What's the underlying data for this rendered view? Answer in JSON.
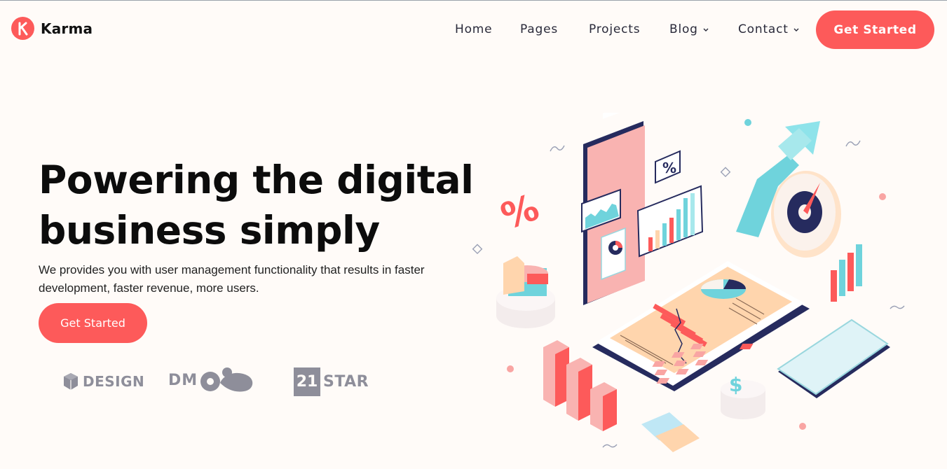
{
  "brand": {
    "name": "Karma",
    "accent": "#fd5a5a"
  },
  "nav": {
    "items": [
      {
        "label": "Home",
        "has_dropdown": false
      },
      {
        "label": "Pages",
        "has_dropdown": false
      },
      {
        "label": "Projects",
        "has_dropdown": false
      },
      {
        "label": "Blog",
        "has_dropdown": true
      },
      {
        "label": "Contact",
        "has_dropdown": true
      }
    ],
    "cta_label": "Get Started"
  },
  "hero": {
    "title_line1": "Powering the digital",
    "title_line2": "business simply",
    "subtitle_line1": "We provides you with user management functionality that results in faster",
    "subtitle_line2": "development, faster revenue, more users.",
    "cta_label": "Get Started"
  },
  "partners": [
    {
      "name": "DESIGN",
      "icon": "cube-icon"
    },
    {
      "name": "DM",
      "icon": "blob-icon"
    },
    {
      "name_number": "21",
      "name_word": "STAR",
      "icon": "square-badge-icon"
    }
  ],
  "colors": {
    "background": "#fffbf8",
    "accent": "#fd5a5a",
    "teal": "#6fd3dc",
    "navy": "#262b5e",
    "peach": "#ffd5ad",
    "pink": "#f9b3b1"
  }
}
